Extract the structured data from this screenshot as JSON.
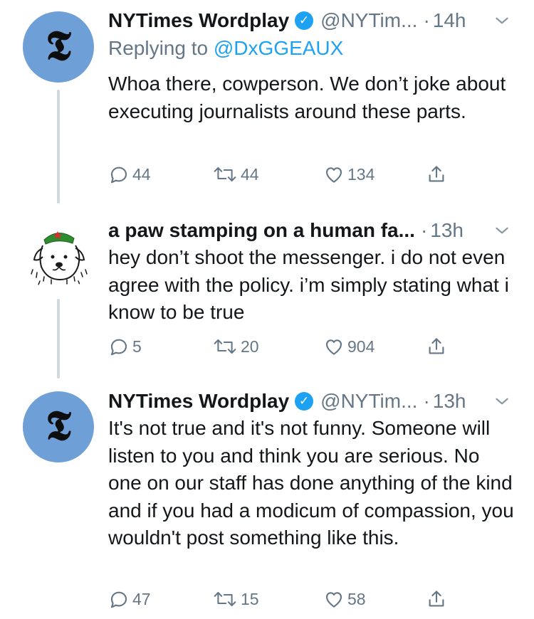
{
  "tweets": [
    {
      "display_name": "NYTimes Wordplay",
      "verified": true,
      "handle": "@NYTim...",
      "separator": "·",
      "time": "14h",
      "replying_prefix": "Replying to",
      "replying_to": "@DxGGEAUX",
      "text": "Whoa there, cowperson. We don’t joke about executing journalists around these parts.",
      "replies": "44",
      "retweets": "44",
      "likes": "134",
      "avatar_icon": "nyt-logo-icon"
    },
    {
      "display_name": "a paw stamping on a human fa...",
      "verified": false,
      "separator": "·",
      "time": "13h",
      "text": "hey don’t shoot the messenger. i do not even agree with the policy. i’m simply stating what i know to be true",
      "replies": "5",
      "retweets": "20",
      "likes": "904",
      "avatar_icon": "dog-drawing-icon"
    },
    {
      "display_name": "NYTimes Wordplay",
      "verified": true,
      "handle": "@NYTim...",
      "separator": "·",
      "time": "13h",
      "text": "It's not true and it's not funny. Someone will listen to you and think you are serious. No one on our staff has done anything of the kind and if you had a modicum of compassion, you wouldn't post something like this.",
      "replies": "47",
      "retweets": "15",
      "likes": "58",
      "avatar_icon": "nyt-logo-icon"
    }
  ],
  "colors": {
    "accent": "#1da1f2",
    "secondary_text": "#657786",
    "thread_line": "#cfd9de",
    "nyt_avatar_bg": "#6e9fd6"
  },
  "nyt_logo_glyph": "𝕿"
}
